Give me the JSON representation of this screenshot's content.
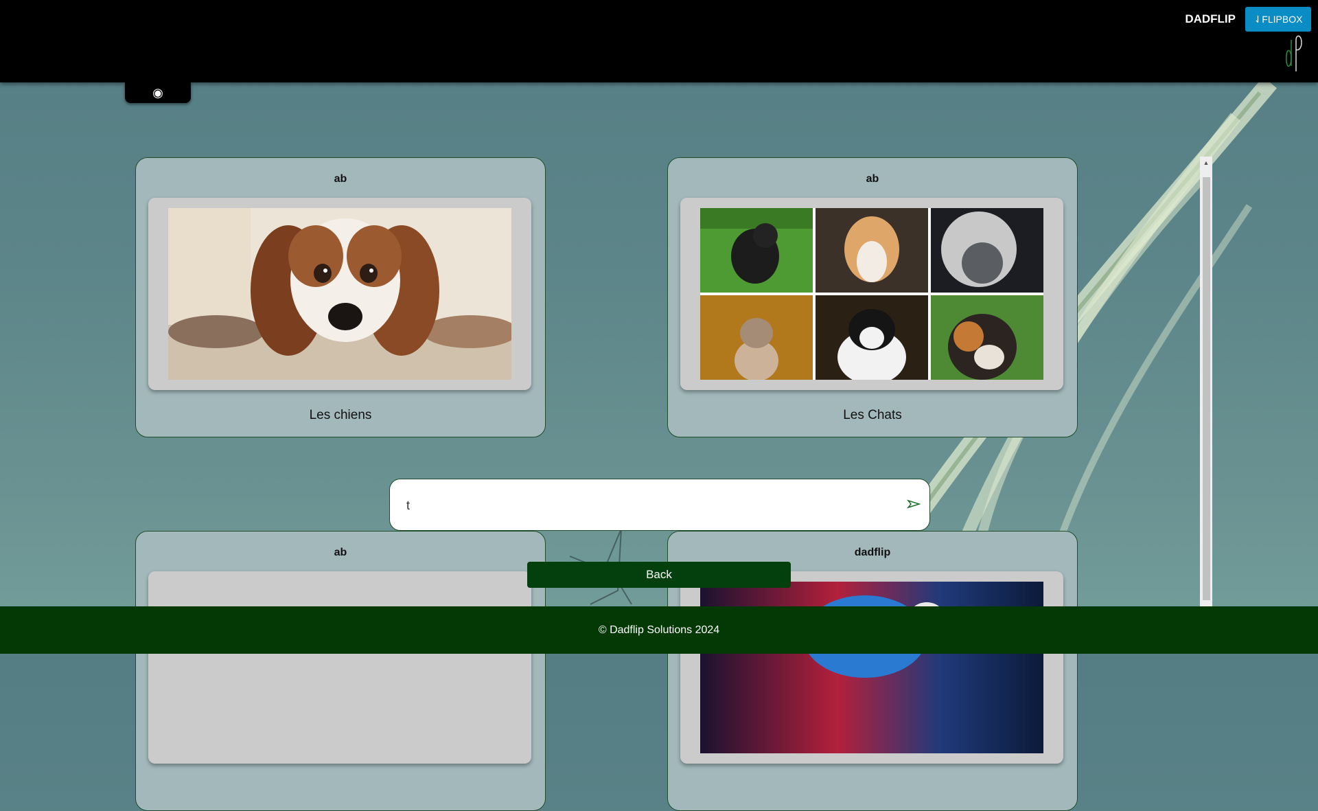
{
  "header": {
    "brand": "DADFLIP",
    "flipbox_label": "⇃FLIPBOX",
    "toggle_icon": "◉"
  },
  "cards": [
    {
      "author": "ab",
      "title": "Les chiens",
      "image": "dog-photo"
    },
    {
      "author": "ab",
      "title": "Les Chats",
      "image": "cat-collage"
    },
    {
      "author": "ab",
      "title": "",
      "image": "blank"
    },
    {
      "author": "dadflip",
      "title": "",
      "image": "colorful-photo"
    }
  ],
  "search": {
    "value": "t",
    "placeholder": ""
  },
  "back_label": "Back",
  "footer": {
    "copyright": "© Dadflip Solutions 2024"
  },
  "colors": {
    "header_bg": "#000000",
    "flipbox_blue": "#0a8cc4",
    "accent_green": "#04400d",
    "card_bg": "#a2b8ba",
    "page_bg": "#5c8589"
  }
}
